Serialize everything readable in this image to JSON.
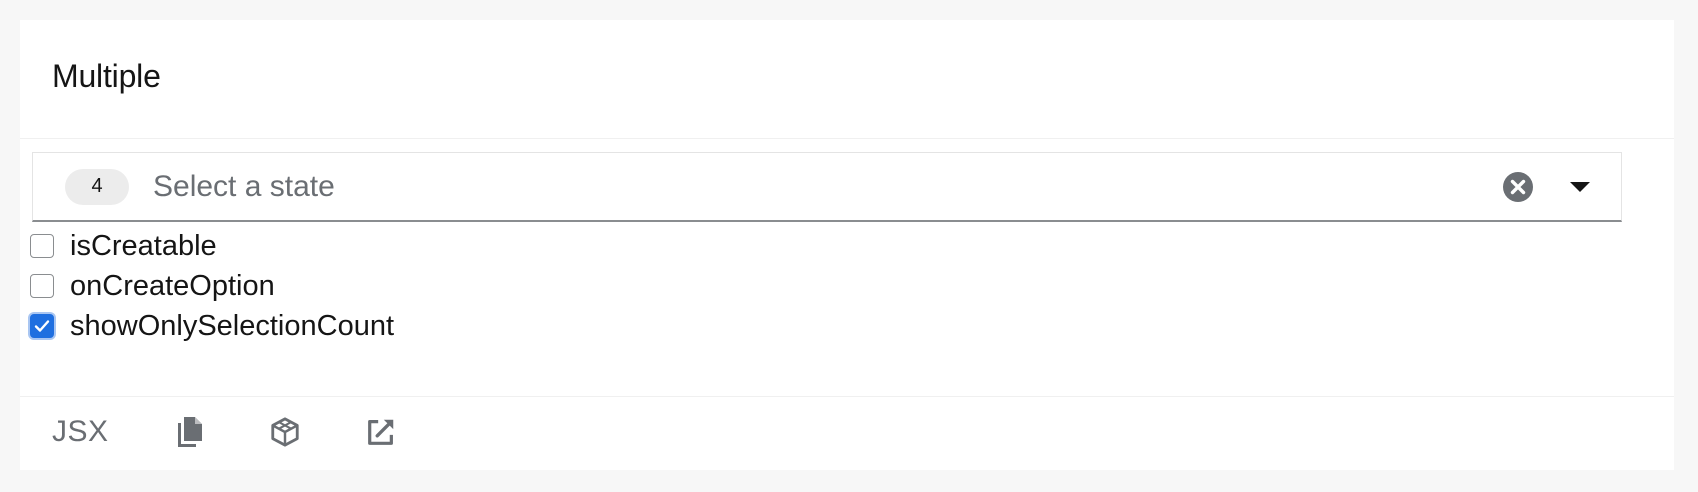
{
  "card": {
    "title": "Multiple"
  },
  "select": {
    "badge_count": "4",
    "placeholder": "Select a state",
    "clear_icon": "clear-circle-icon",
    "toggle_icon": "caret-down-icon"
  },
  "options": [
    {
      "label": "isCreatable",
      "checked": false
    },
    {
      "label": "onCreateOption",
      "checked": false
    },
    {
      "label": "showOnlySelectionCount",
      "checked": true
    }
  ],
  "footer": {
    "jsx_label": "JSX",
    "icons": [
      "copy-icon",
      "codesandbox-icon",
      "external-link-icon"
    ]
  },
  "colors": {
    "accent": "#1f6fe0",
    "icon_gray": "#6a6e73"
  }
}
